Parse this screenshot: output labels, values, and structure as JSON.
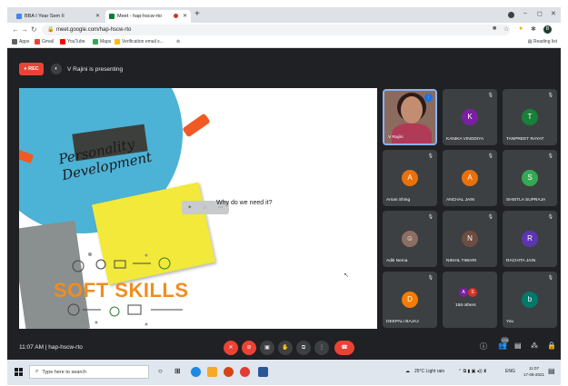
{
  "browser": {
    "tabs": [
      {
        "label": "BBA I Year Sem II",
        "favicon_color": "#4285f4"
      },
      {
        "label": "Meet - hap-hscw-rto",
        "favicon_color": "#00832d",
        "active": true
      }
    ],
    "new_tab": "+",
    "url": "meet.google.com/hap-hscw-rto",
    "profile_initial": "B",
    "bookmarks": [
      {
        "label": "Apps",
        "color": "#5f6368"
      },
      {
        "label": "Gmail",
        "color": "#ea4335"
      },
      {
        "label": "YouTube",
        "color": "#ff0000"
      },
      {
        "label": "Maps",
        "color": "#34a853"
      },
      {
        "label": "Verification email s...",
        "color": "#fbbc04"
      }
    ],
    "reading_list": "Reading list"
  },
  "meet": {
    "rec_label": "REC",
    "presenter_text": "V Rajini is presenting",
    "slide": {
      "sticky_title": "Personality Development",
      "question": "Why do we need it?",
      "soft_skills": "SOFT SKILLS"
    },
    "participants": [
      {
        "name": "V Rajini",
        "self": true
      },
      {
        "name": "KANIKA VINODIYA",
        "initial": "K",
        "color": "#7b1fa2"
      },
      {
        "name": "TANPREET RAYAT",
        "initial": "T",
        "color": "#188038"
      },
      {
        "name": "Aman Shing",
        "initial": "A",
        "color": "#e8710a"
      },
      {
        "name": "ANCHAL JAIN",
        "initial": "A",
        "color": "#e8710a"
      },
      {
        "name": "SHISTLA SUPRAJA",
        "initial": "S",
        "color": "#34a853"
      },
      {
        "name": "Aditi Nema",
        "initial": "",
        "color": "#8d6e63"
      },
      {
        "name": "NIKHIL TIWARI",
        "initial": "N",
        "color": "#6d4c41"
      },
      {
        "name": "RACHITA JAIN",
        "initial": "R",
        "color": "#5e35b1"
      },
      {
        "name": "DEEPALI BAJAJ",
        "initial": "D",
        "color": "#f57c00"
      },
      {
        "name": "158 others",
        "others": true
      },
      {
        "name": "You",
        "initial": "b",
        "color": "#00796b"
      }
    ],
    "others_avatars": [
      {
        "initial": "A",
        "color": "#7b1fa2"
      },
      {
        "initial": "S",
        "color": "#d93025"
      }
    ],
    "time": "11:07 AM",
    "meeting_code": "hap-hscw-rto",
    "participant_count": "170"
  },
  "taskbar": {
    "search_placeholder": "Type here to search",
    "weather": "25°C Light rain",
    "lang": "ENG",
    "clock_time": "11:07",
    "clock_date": "17-08-2021"
  }
}
